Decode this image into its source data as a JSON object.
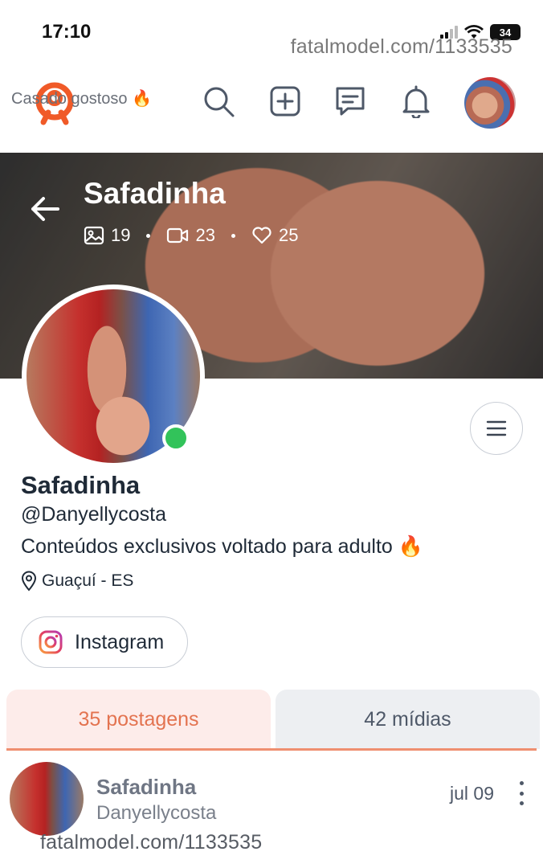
{
  "status_bar": {
    "time": "17:10",
    "battery": "34"
  },
  "watermark_top": "fatalmodel.com/1133535",
  "watermark_bottom": "fatalmodel.com/1133535",
  "colors": {
    "accent": "#e37350",
    "online": "#32c35a",
    "logo": "#f05a28"
  },
  "header": {
    "icons": [
      "search-icon",
      "add-post-icon",
      "messages-icon",
      "notifications-icon"
    ]
  },
  "cover": {
    "title": "Safadinha",
    "stats": {
      "photos": "19",
      "videos": "23",
      "likes": "25"
    }
  },
  "profile": {
    "name": "Safadinha",
    "handle": "@Danyellycosta",
    "bio": "Conteúdos exclusivos voltado para adulto 🔥",
    "location": "Guaçuí - ES",
    "instagram_label": "Instagram"
  },
  "tabs": [
    {
      "label": "35 postagens",
      "active": true
    },
    {
      "label": "42 mídias",
      "active": false
    }
  ],
  "post": {
    "name": "Safadinha",
    "handle": "Danyellycosta",
    "date": "jul 09",
    "caption": "Casado gostoso 🔥"
  }
}
